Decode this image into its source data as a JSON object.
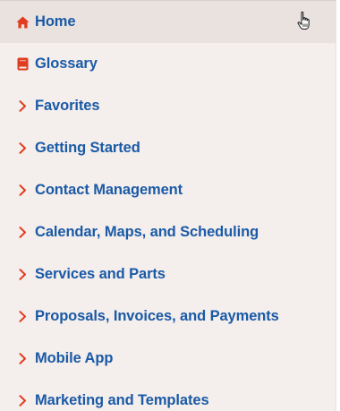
{
  "nav": {
    "items": [
      {
        "label": "Home",
        "icon": "home-icon",
        "active": true
      },
      {
        "label": "Glossary",
        "icon": "book-icon"
      },
      {
        "label": "Favorites",
        "icon": "chevron-right-icon"
      },
      {
        "label": "Getting Started",
        "icon": "chevron-right-icon"
      },
      {
        "label": "Contact Management",
        "icon": "chevron-right-icon"
      },
      {
        "label": "Calendar, Maps, and Scheduling",
        "icon": "chevron-right-icon"
      },
      {
        "label": "Services and Parts",
        "icon": "chevron-right-icon"
      },
      {
        "label": "Proposals, Invoices, and Payments",
        "icon": "chevron-right-icon"
      },
      {
        "label": "Mobile App",
        "icon": "chevron-right-icon"
      },
      {
        "label": "Marketing and Templates",
        "icon": "chevron-right-icon"
      }
    ]
  },
  "colors": {
    "accent_icon": "#e03c1f",
    "link_text": "#1a5aa6",
    "background": "#f4eeec",
    "active_background": "#eae2df"
  }
}
